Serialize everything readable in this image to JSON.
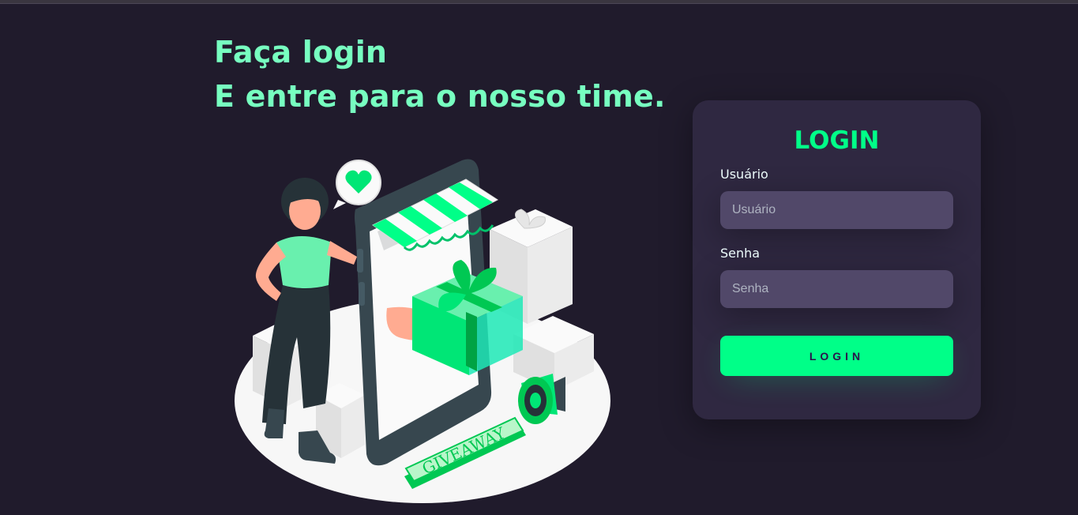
{
  "hero": {
    "line1": "Faça login",
    "line2": "E entre para o nosso time.",
    "illustration_label": "GIVEAWAY"
  },
  "login": {
    "title": "LOGIN",
    "user_label": "Usuário",
    "user_placeholder": "Usuário",
    "pass_label": "Senha",
    "pass_placeholder": "Senha",
    "button_label": "LOGIN"
  },
  "colors": {
    "background": "#201b2c",
    "card": "#2f2841",
    "accent": "#00ff88",
    "headline": "#77ffc0",
    "input": "#514869"
  }
}
